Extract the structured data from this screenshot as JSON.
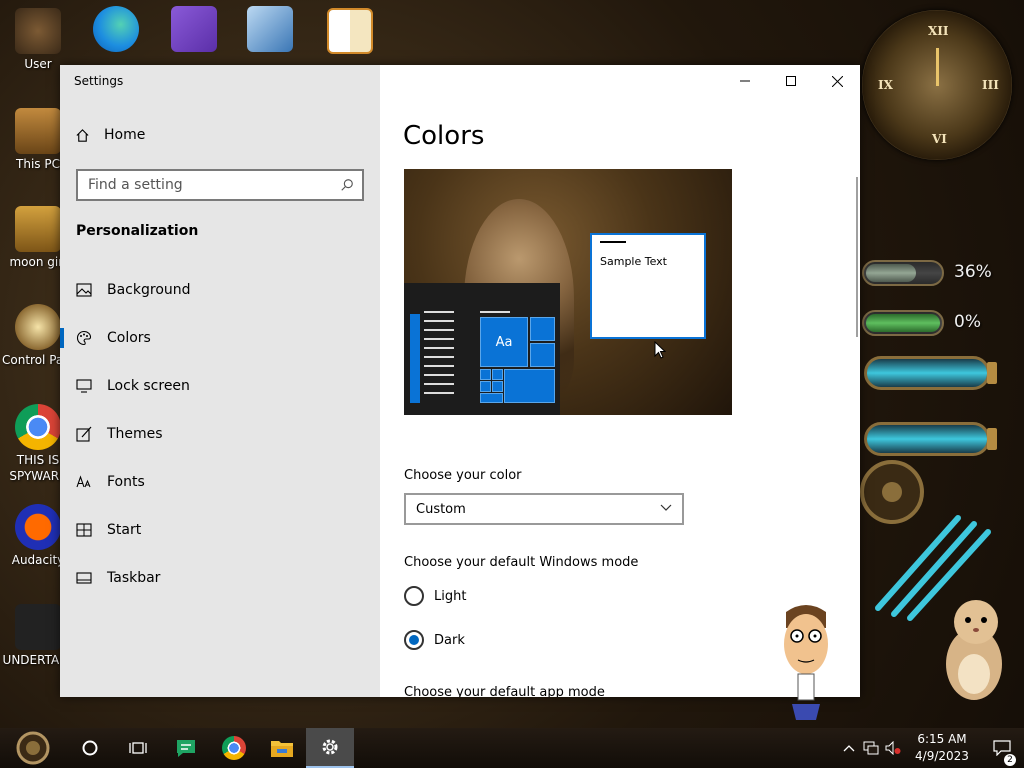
{
  "desktop": {
    "icons": [
      {
        "label": "User"
      },
      {
        "label": ""
      },
      {
        "label": ""
      },
      {
        "label": ""
      },
      {
        "label": ""
      },
      {
        "label": "This PC"
      },
      {
        "label": "moon girl"
      },
      {
        "label": "Control Panel"
      },
      {
        "label": "THIS IS SPYWARE"
      },
      {
        "label": "Audacity"
      },
      {
        "label": "UNDERTALE"
      }
    ],
    "gauges": [
      {
        "value": "36%",
        "fraction": 0.36
      },
      {
        "value": "0%",
        "fraction": 0.0
      }
    ]
  },
  "window": {
    "title": "Settings",
    "sidebar": {
      "home": "Home",
      "search_placeholder": "Find a setting",
      "section": "Personalization",
      "items": [
        {
          "label": "Background",
          "icon": "picture-icon"
        },
        {
          "label": "Colors",
          "icon": "palette-icon",
          "active": true
        },
        {
          "label": "Lock screen",
          "icon": "monitor-icon"
        },
        {
          "label": "Themes",
          "icon": "brush-icon"
        },
        {
          "label": "Fonts",
          "icon": "font-icon"
        },
        {
          "label": "Start",
          "icon": "start-icon"
        },
        {
          "label": "Taskbar",
          "icon": "taskbar-icon"
        }
      ]
    },
    "main": {
      "title": "Colors",
      "preview": {
        "aa": "Aa",
        "sample_text": "Sample Text"
      },
      "choose_color_label": "Choose your color",
      "color_value": "Custom",
      "windows_mode_label": "Choose your default Windows mode",
      "modes": [
        {
          "label": "Light",
          "selected": false
        },
        {
          "label": "Dark",
          "selected": true
        }
      ],
      "app_mode_label": "Choose your default app mode"
    }
  },
  "taskbar": {
    "time": "6:15 AM",
    "date": "4/9/2023",
    "notifications": "2"
  },
  "colors": {
    "accent": "#0067c0",
    "tile_blue": "#0a73d6",
    "sidebar_bg": "#e6e6e6"
  }
}
